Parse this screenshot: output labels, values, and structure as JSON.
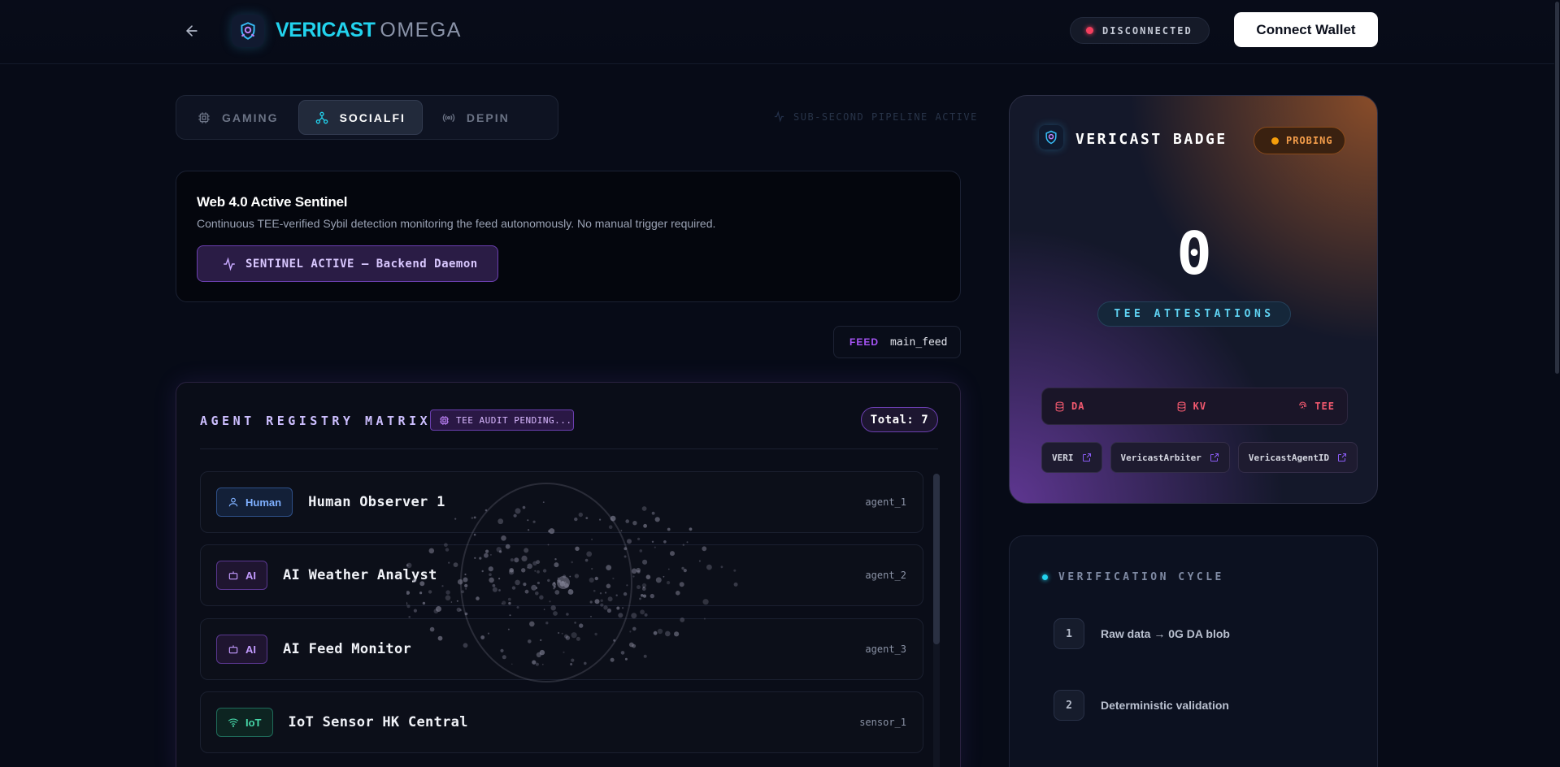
{
  "header": {
    "brand": "VERICAST",
    "brand_sub": "OMEGA",
    "status": "DISCONNECTED",
    "connect_label": "Connect Wallet"
  },
  "tabs": [
    {
      "label": "GAMING",
      "icon": "cpu-icon",
      "active": false
    },
    {
      "label": "SOCIALFI",
      "icon": "network-icon",
      "active": true
    },
    {
      "label": "DEPIN",
      "icon": "radio-icon",
      "active": false
    }
  ],
  "pipeline_status": "SUB-SECOND PIPELINE ACTIVE",
  "sentinel": {
    "title": "Web 4.0 Active Sentinel",
    "description": "Continuous TEE-verified Sybil detection monitoring the feed autonomously. No manual trigger required.",
    "button_label": "SENTINEL ACTIVE — Backend Daemon"
  },
  "feed": {
    "label": "FEED",
    "value": "main_feed"
  },
  "registry": {
    "title": "AGENT REGISTRY MATRIX",
    "audit_badge": "TEE AUDIT PENDING...",
    "total": "Total: 7",
    "agents": [
      {
        "type": "Human",
        "name": "Human Observer 1",
        "id": "agent_1"
      },
      {
        "type": "AI",
        "name": "AI Weather Analyst",
        "id": "agent_2"
      },
      {
        "type": "AI",
        "name": "AI Feed Monitor",
        "id": "agent_3"
      },
      {
        "type": "IoT",
        "name": "IoT Sensor HK Central",
        "id": "sensor_1"
      }
    ]
  },
  "badge_card": {
    "title": "VERICAST BADGE",
    "state": "PROBING",
    "count": "0",
    "count_label": "TEE ATTESTATIONS",
    "layers": [
      "DA",
      "KV",
      "TEE"
    ],
    "contracts": [
      "VERI",
      "VericastArbiter",
      "VericastAgentID"
    ]
  },
  "cycle": {
    "title": "VERIFICATION CYCLE",
    "steps": [
      {
        "num": "1",
        "label": "Raw data → 0G DA blob"
      },
      {
        "num": "2",
        "label": "Deterministic validation"
      }
    ]
  },
  "colors": {
    "accent_cyan": "#22d3ee",
    "accent_purple": "#a855f7",
    "status_red": "#f43f5e",
    "probing_orange": "#f59e0b"
  }
}
